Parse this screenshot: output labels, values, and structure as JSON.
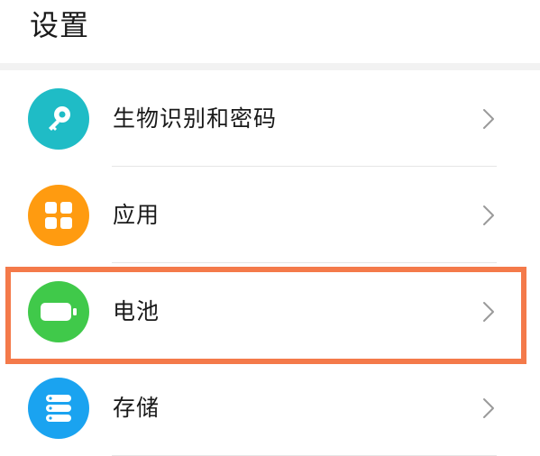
{
  "header": {
    "title": "设置"
  },
  "items": [
    {
      "label": "生物识别和密码",
      "icon": "key-icon",
      "color": "#1fbcc6"
    },
    {
      "label": "应用",
      "icon": "apps-grid-icon",
      "color": "#ff9b10"
    },
    {
      "label": "电池",
      "icon": "battery-icon",
      "color": "#40c94a"
    },
    {
      "label": "存储",
      "icon": "storage-icon",
      "color": "#1aa3f0"
    }
  ],
  "highlight": {
    "color": "#f47a4a",
    "target": "电池"
  }
}
